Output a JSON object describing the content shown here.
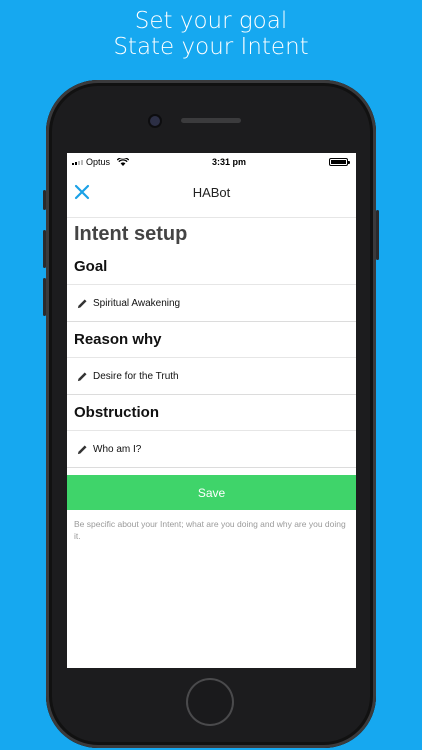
{
  "headline": {
    "line1": "Set your goal",
    "line2": "State your Intent"
  },
  "status_bar": {
    "carrier": "Optus",
    "time": "3:31 pm"
  },
  "navbar": {
    "title": "HABot",
    "close_icon": "close-icon",
    "accent_color": "#1aa1e6"
  },
  "page": {
    "title": "Intent setup"
  },
  "sections": [
    {
      "label": "Goal",
      "value": "Spiritual Awakening"
    },
    {
      "label": "Reason why",
      "value": "Desire for the Truth"
    },
    {
      "label": "Obstruction",
      "value": "Who am I?"
    }
  ],
  "save_button": {
    "label": "Save",
    "color": "#3fd46a"
  },
  "helper_text": "Be specific about your Intent; what are you doing and why are you doing it."
}
